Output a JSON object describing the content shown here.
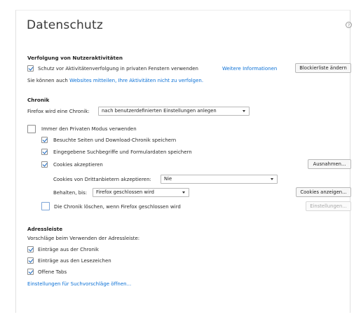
{
  "page": {
    "title": "Datenschutz",
    "help_glyph": "?"
  },
  "tracking": {
    "heading": "Verfolgung von Nutzeraktivitäten",
    "checkbox_label": "Schutz vor Aktivitätenverfolgung in privaten Fenstern verwenden",
    "more_info_link": "Weitere Informationen",
    "blocklist_button": "Blockierliste ändern",
    "dnt_prefix": "Sie können auch ",
    "dnt_link": "Websites mitteilen, Ihre Aktivitäten nicht zu verfolgen."
  },
  "history": {
    "heading": "Chronik",
    "mode_label": "Firefox wird eine Chronik:",
    "mode_value": "nach benutzerdefinierten Einstellungen anlegen",
    "private_mode": "Immer den Privaten Modus verwenden",
    "remember_browsing": "Besuchte Seiten und Download-Chronik speichern",
    "remember_search": "Eingegebene Suchbegriffe und Formulardaten speichern",
    "accept_cookies": "Cookies akzeptieren",
    "exceptions_button": "Ausnahmen...",
    "third_party_label": "Cookies von Drittanbietern akzeptieren:",
    "third_party_value": "Nie",
    "keep_until_label": "Behalten, bis:",
    "keep_until_value": "Firefox geschlossen wird",
    "show_cookies_button": "Cookies anzeigen...",
    "clear_on_close": "Die Chronik löschen, wenn Firefox geschlossen wird",
    "settings_button": "Einstellungen..."
  },
  "address_bar": {
    "heading": "Adressleiste",
    "intro": "Vorschläge beim Verwenden der Adressleiste:",
    "history_item": "Einträge aus der Chronik",
    "bookmarks_item": "Einträge aus den Lesezeichen",
    "tabs_item": "Offene Tabs",
    "suggestion_settings_link": "Einstellungen für Suchvorschläge öffnen..."
  },
  "colors": {
    "accent": "#0a70d6",
    "check": "#1565c0"
  }
}
